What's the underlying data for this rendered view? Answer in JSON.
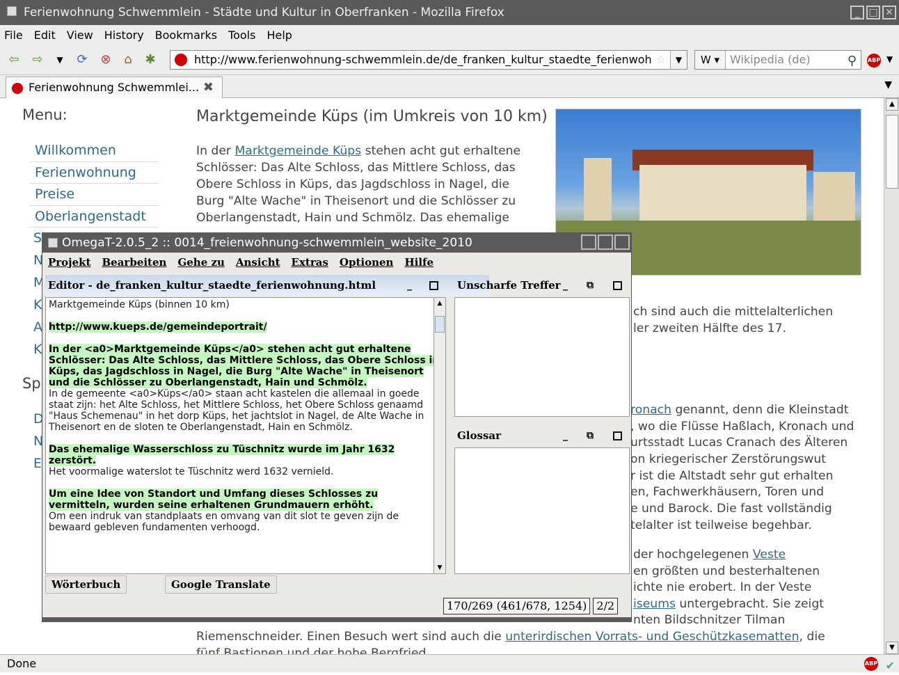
{
  "firefox": {
    "window_title": "Ferienwohnung Schwemmlein - Städte und Kultur in Oberfranken - Mozilla Firefox",
    "menu": [
      "File",
      "Edit",
      "View",
      "History",
      "Bookmarks",
      "Tools",
      "Help"
    ],
    "url": "http://www.ferienwohnung-schwemmlein.de/de_franken_kultur_staedte_ferienwoh",
    "search_engine": "W",
    "search_placeholder": "Wikipedia (de)",
    "tab_title": "Ferienwohnung Schwemmlei...",
    "status": "Done",
    "abp_label": "ABP",
    "icons": [
      "back-icon",
      "forward-icon",
      "dropdown-icon",
      "reload-icon",
      "stop-icon",
      "home-icon",
      "bookmark-icon",
      "star-icon",
      "search-icon",
      "adblock-icon",
      "close-tab-icon"
    ]
  },
  "page": {
    "menu_heading": "Menu:",
    "menu_items": [
      "Willkommen",
      "Ferienwohnung",
      "Preise",
      "Oberlangenstadt"
    ],
    "menu_partial_letters": [
      "S",
      "N",
      "M",
      "K",
      "A",
      "K"
    ],
    "section2_heading": "Sp",
    "section2_letters": [
      "D",
      "N",
      "E"
    ],
    "article_heading": "Marktgemeinde Küps (im Umkreis von 10 km)",
    "article_lines": [
      {
        "pre": "In der ",
        "link": "Marktgemeinde Küps",
        "post": " stehen acht gut erhaltene"
      },
      {
        "pre": "Schlösser: Das Alte Schloss, das Mittlere Schloss, das",
        "link": "",
        "post": ""
      },
      {
        "pre": "Obere Schloss in Küps, das Jagdschloss in Nagel, die",
        "link": "",
        "post": ""
      },
      {
        "pre": "Burg \"Alte Wache\" in Theisenort und die Schlösser zu",
        "link": "",
        "post": ""
      },
      {
        "pre": "Oberlangenstadt, Hain und Schmölz. Das ehemalige",
        "link": "",
        "post": ""
      }
    ],
    "right_lines_1": [
      "ch sind auch die mittelalterlichen",
      "ler zweiten Hälfte des 17."
    ],
    "right_lines_2": [
      {
        "pre": "",
        "link": "ronach",
        "post": " genannt, denn die Kleinstadt"
      },
      {
        "pre": ", wo die Flüsse Haßlach, Kronach und",
        "link": "",
        "post": ""
      },
      {
        "pre": "urtsstadt Lucas Cranach des Älteren",
        "link": "",
        "post": ""
      },
      {
        "pre": "on kriegerischer Zerstörungswut",
        "link": "",
        "post": ""
      },
      {
        "pre": "r ist die Altstadt sehr gut erhalten",
        "link": "",
        "post": ""
      },
      {
        "pre": "en, Fachwerkhäusern, Toren und",
        "link": "",
        "post": ""
      },
      {
        "pre": "e und Barock. Die fast vollständig",
        "link": "",
        "post": ""
      },
      {
        "pre": "telalter ist teilweise begehbar.",
        "link": "",
        "post": ""
      }
    ],
    "right_lines_3": [
      {
        "pre": "der hochgelegenen ",
        "link": "Veste",
        "post": ""
      },
      {
        "pre": "en größten und besterhaltenen",
        "link": "",
        "post": ""
      },
      {
        "pre": "ichte nie erobert. In der Veste",
        "link": "",
        "post": ""
      },
      {
        "pre": "",
        "link": "iseums",
        "post": " untergebracht. Sie zeigt"
      },
      {
        "pre": "nten Bildschnitzer Tilman",
        "link": "",
        "post": ""
      }
    ],
    "bottom_line_1": {
      "pre": "Riemenschneider. Einen Besuch wert sind auch die ",
      "link": "unterirdischen Vorrats- und Geschützkasematten",
      "post": ", die"
    },
    "bottom_line_2": "fünf Bastionen und der hohe Bergfried"
  },
  "omegat": {
    "title": "OmegaT-2.0.5_2 :: 0014_freienwohnung-schwemmlein_website_2010",
    "menu": [
      "Projekt",
      "Bearbeiten",
      "Gehe zu",
      "Ansicht",
      "Extras",
      "Optionen",
      "Hilfe"
    ],
    "editor_title": "Editor - de_franken_kultur_staedte_ferienwohnung.html",
    "editor_top_line": "Marktgemeinde Küps (binnen 10 km)",
    "segments": [
      {
        "src": "http://www.kueps.de/gemeindeportrait/",
        "tr": ""
      },
      {
        "src": "In der <a0>Marktgemeinde Küps</a0> stehen acht gut erhaltene Schlösser: Das Alte Schloss, das Mittlere Schloss, das Obere Schloss in Küps, das Jagdschloss in Nagel, die Burg \"Alte Wache\" in Theisenort und die Schlösser zu Oberlangenstadt, Hain und Schmölz.",
        "tr": "In de gemeente <a0>Küps</a0> staan acht kastelen die allemaal in goede staat zijn: het Alte Schloss, het Mittlere Schloss, het Obere Schloss genaamd \"Haus Schemenau\" in het dorp Küps, het jachtslot in Nagel, de Alte Wache in Theisenort en de sloten te Oberlangenstadt, Hain en Schmölz."
      },
      {
        "src": "Das ehemalige Wasserschloss zu Tüschnitz wurde im Jahr 1632 zerstört.",
        "tr": "Het voormalige waterslot te Tüschnitz werd 1632 vernield."
      },
      {
        "src": "Um eine Idee von Standort und Umfang dieses Schlosses zu vermitteln, wurden seine erhaltenen Grundmauern erhöht.",
        "tr": "Om een indruk van standplaats en omvang van dit slot te geven zijn de bewaard gebleven fundamenten verhoogd."
      }
    ],
    "fuzzy_title": "Unscharfe Treffer",
    "glossary_title": "Glossar",
    "tab_dictionary": "Wörterbuch",
    "tab_google": "Google Translate",
    "progress": "170/269 (461/678, 1254)",
    "segment_count": "2/2",
    "min_glyph": "_",
    "float_glyph": "⧉"
  }
}
